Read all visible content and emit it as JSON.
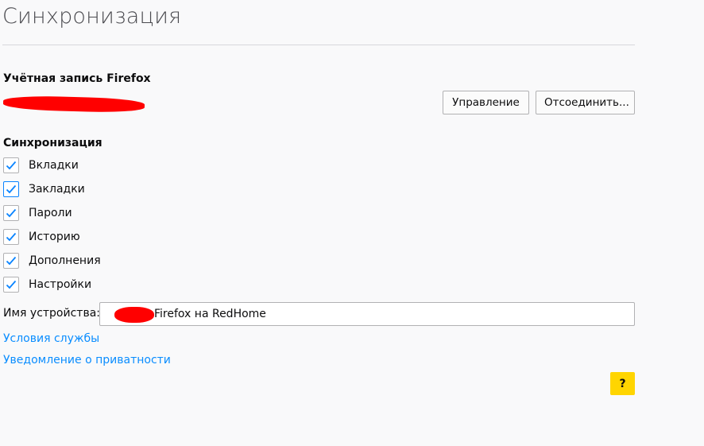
{
  "page": {
    "title": "Синхронизация"
  },
  "account": {
    "heading": "Учётная запись Firefox",
    "manage_label": "Управление",
    "disconnect_label": "Отсоединить..."
  },
  "sync": {
    "heading": "Синхронизация",
    "items": [
      {
        "label": "Вкладки",
        "checked": true
      },
      {
        "label": "Закладки",
        "checked": true
      },
      {
        "label": "Пароли",
        "checked": true
      },
      {
        "label": "Историю",
        "checked": true
      },
      {
        "label": "Дополнения",
        "checked": true
      },
      {
        "label": "Настройки",
        "checked": true
      }
    ]
  },
  "device": {
    "label": "Имя устройства:",
    "value": "Firefox на RedHome"
  },
  "links": {
    "terms": "Условия службы",
    "privacy": "Уведомление о приватности"
  },
  "help": {
    "label": "?"
  },
  "colors": {
    "accent": "#0a84ff",
    "link": "#0a8dff",
    "help_button": "#ffd500",
    "redaction": "#ff0000"
  }
}
